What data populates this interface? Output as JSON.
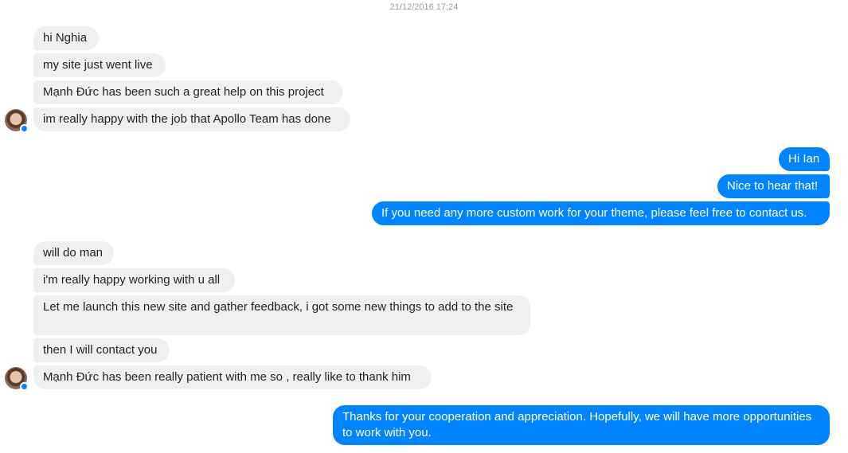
{
  "timestamp": "21/12/2016 17:24",
  "colors": {
    "incoming_bubble": "#f1f0f0",
    "outgoing_bubble": "#0084ff",
    "messenger_badge": "#0084ff"
  },
  "messages": {
    "m1": "hi Nghia",
    "m2": "my site just went live",
    "m3": "Mạnh Đức has been such a great help on this project",
    "m4": "im really happy with the job that Apollo Team has done",
    "m5": "Hi Ian",
    "m6": "Nice to hear that!",
    "m7": "If you need any more custom work for your theme, please feel free to contact us.",
    "m8": "will do man",
    "m9": "i'm really happy working with u all",
    "m10": "Let me launch this new site and gather feedback, i got some new things to add to the site",
    "m11": "then I will contact you",
    "m12": "Mạnh Đức has been really patient with me so , really like to thank him",
    "m13": "Thanks for your cooperation and appreciation. Hopefully, we will have more opportunities to work with you."
  },
  "icons": {
    "avatar": "avatar-icon",
    "badge": "messenger-badge-icon"
  }
}
